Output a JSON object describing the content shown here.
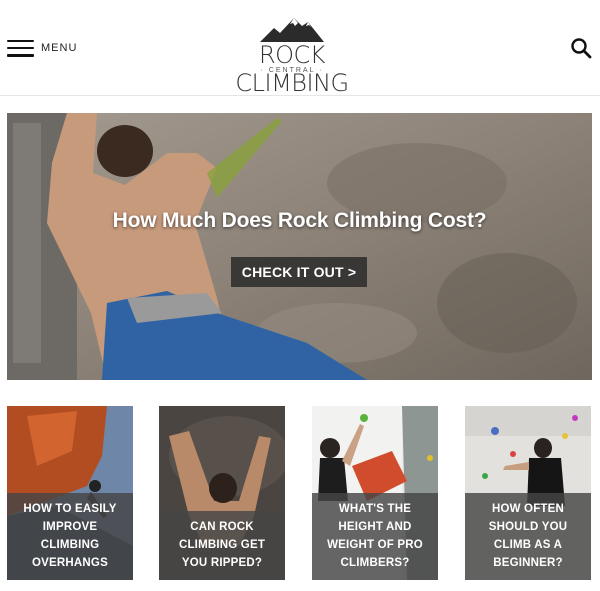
{
  "header": {
    "menu_label": "MENU",
    "logo_title": "ROCK CLIMBING",
    "logo_subtitle": "· CENTRAL ·"
  },
  "hero": {
    "title": "How Much Does Rock Climbing Cost?",
    "cta_label": "CHECK IT OUT >"
  },
  "cards": [
    {
      "caption": "HOW TO EASILY IMPROVE CLIMBING OVERHANGS"
    },
    {
      "caption": "CAN ROCK CLIMBING GET YOU RIPPED?"
    },
    {
      "caption": "WHAT'S THE HEIGHT AND WEIGHT OF PRO CLIMBERS?"
    },
    {
      "caption": "HOW OFTEN SHOULD YOU CLIMB AS A BEGINNER?"
    }
  ],
  "icons": {
    "menu": "hamburger-icon",
    "search": "search-icon",
    "logo": "mountain-logo-icon"
  }
}
